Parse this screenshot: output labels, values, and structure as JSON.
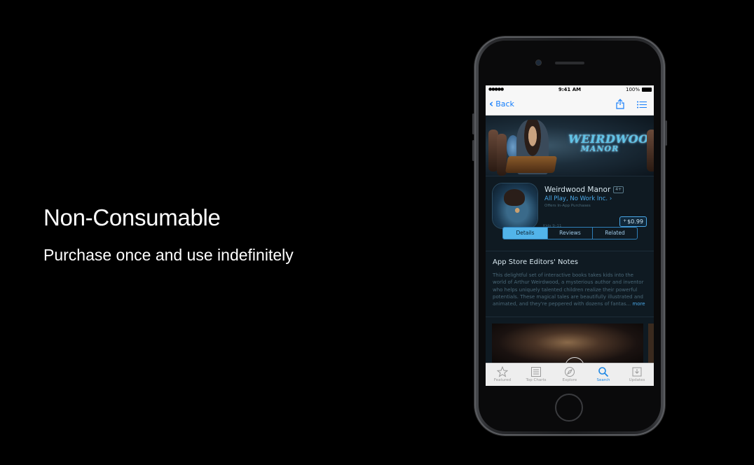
{
  "slide": {
    "title": "Non-Consumable",
    "subtitle": "Purchase once and use indefinitely"
  },
  "status_bar": {
    "signal": "●●●●● ",
    "time": "9:41 AM",
    "battery": "100%"
  },
  "nav": {
    "back_label": "Back"
  },
  "banner": {
    "logo_line1": "WEIRDWOOD",
    "logo_line2": "MANOR"
  },
  "app": {
    "name": "Weirdwood Manor",
    "age_rating": "4+",
    "developer": "All Play, No Work Inc. ›",
    "iap_note": "Offers In-App Purchases",
    "age_range": "Kids 9–11",
    "price": "$0.99",
    "price_plus": "+"
  },
  "segments": [
    {
      "label": "Details",
      "active": true
    },
    {
      "label": "Reviews",
      "active": false
    },
    {
      "label": "Related",
      "active": false
    }
  ],
  "notes": {
    "title": "App Store Editors' Notes",
    "body": "This delightful set of interactive books takes kids into the world of Arthur Weirdwood, a mysterious author and inventor who helps uniquely talented children realize their powerful potentials. These magical tales are beautifully illustrated and animated, and they're peppered with dozens of fantas...",
    "more": "more"
  },
  "tabbar": [
    {
      "label": "Featured",
      "icon": "star-icon"
    },
    {
      "label": "Top Charts",
      "icon": "list-icon"
    },
    {
      "label": "Explore",
      "icon": "compass-icon"
    },
    {
      "label": "Search",
      "icon": "search-icon"
    },
    {
      "label": "Updates",
      "icon": "download-icon"
    }
  ],
  "colors": {
    "accent": "#157efb",
    "tab_active": "#1e88e5",
    "segment_active": "#52b4ea"
  }
}
